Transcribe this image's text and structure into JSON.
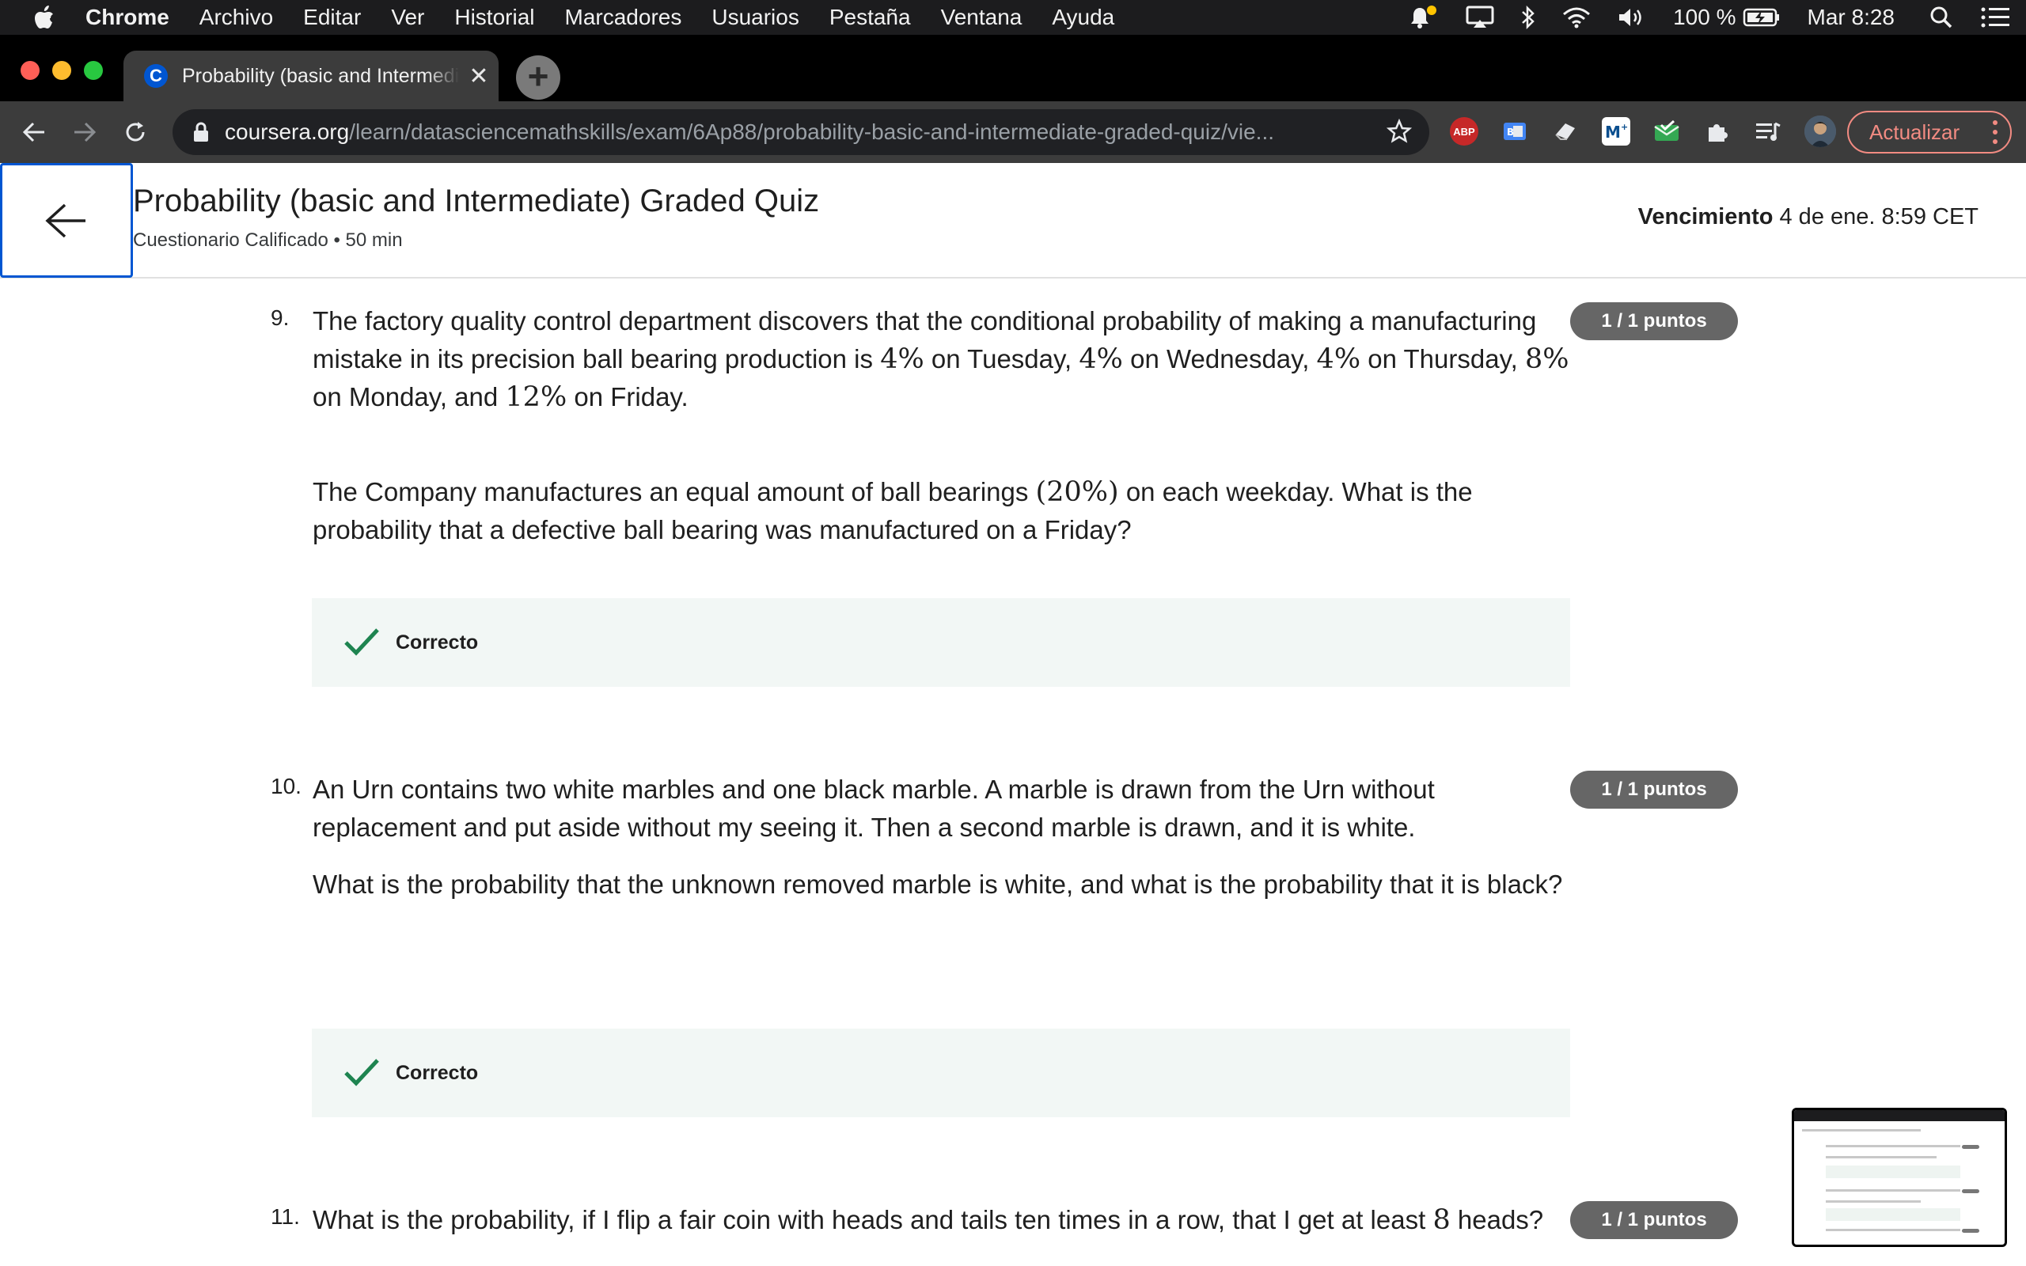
{
  "menubar": {
    "app": "Chrome",
    "items": [
      "Archivo",
      "Editar",
      "Ver",
      "Historial",
      "Marcadores",
      "Usuarios",
      "Pestaña",
      "Ventana",
      "Ayuda"
    ],
    "battery": "100 %",
    "clock": "Mar 8:28"
  },
  "browser": {
    "tab_title": "Probability (basic and Intermediate) Graded Quiz",
    "favicon_letter": "C",
    "url_host": "coursera.org",
    "url_path": "/learn/datasciencemathskills/exam/6Ap88/probability-basic-and-intermediate-graded-quiz/vie...",
    "extension_abp": "ABP",
    "update_label": "Actualizar"
  },
  "header": {
    "title": "Probability (basic and Intermediate) Graded Quiz",
    "subtitle": "Cuestionario Calificado • 50 min",
    "due_label": "Vencimiento",
    "due_value": "4 de ene. 8:59 CET"
  },
  "questions": [
    {
      "number": "9.",
      "points": "1 / 1 puntos",
      "p1_a": "The factory quality control department discovers that the conditional probability of making a manufacturing mistake in its precision ball bearing production is ",
      "p1_m1": "4%",
      "p1_b": " on Tuesday, ",
      "p1_m2": "4%",
      "p1_c": " on Wednesday, ",
      "p1_m3": "4%",
      "p1_d": " on Thursday, ",
      "p1_m4": "8%",
      "p1_e": " on Monday, and ",
      "p1_m5": "12%",
      "p1_f": " on Friday.",
      "p2_a": "The Company manufactures an equal amount of ball bearings ",
      "p2_m1": "(20%)",
      "p2_b": " on each weekday.  What is the probability that a defective ball bearing was manufactured on a Friday?",
      "feedback": "Correcto"
    },
    {
      "number": "10.",
      "points": "1 / 1 puntos",
      "p1": "An Urn contains two white marbles and one black marble. A marble is drawn from the Urn without replacement and put aside without my seeing it. Then a second marble is drawn, and it is white.",
      "p2": "What is the probability that the unknown removed marble is white, and what is the probability that it is black?",
      "feedback": "Correcto"
    },
    {
      "number": "11.",
      "points": "1 / 1 puntos",
      "p1_a": "What is the probability, if I flip a fair coin with heads and tails ten times in a row, that I get at least ",
      "p1_m1": "8",
      "p1_b": " heads?"
    }
  ],
  "colors": {
    "accent": "#0056d2",
    "badge": "#666666",
    "feedback_bg": "#f2f7f5",
    "check": "#1e8450",
    "update": "#f28b82"
  }
}
